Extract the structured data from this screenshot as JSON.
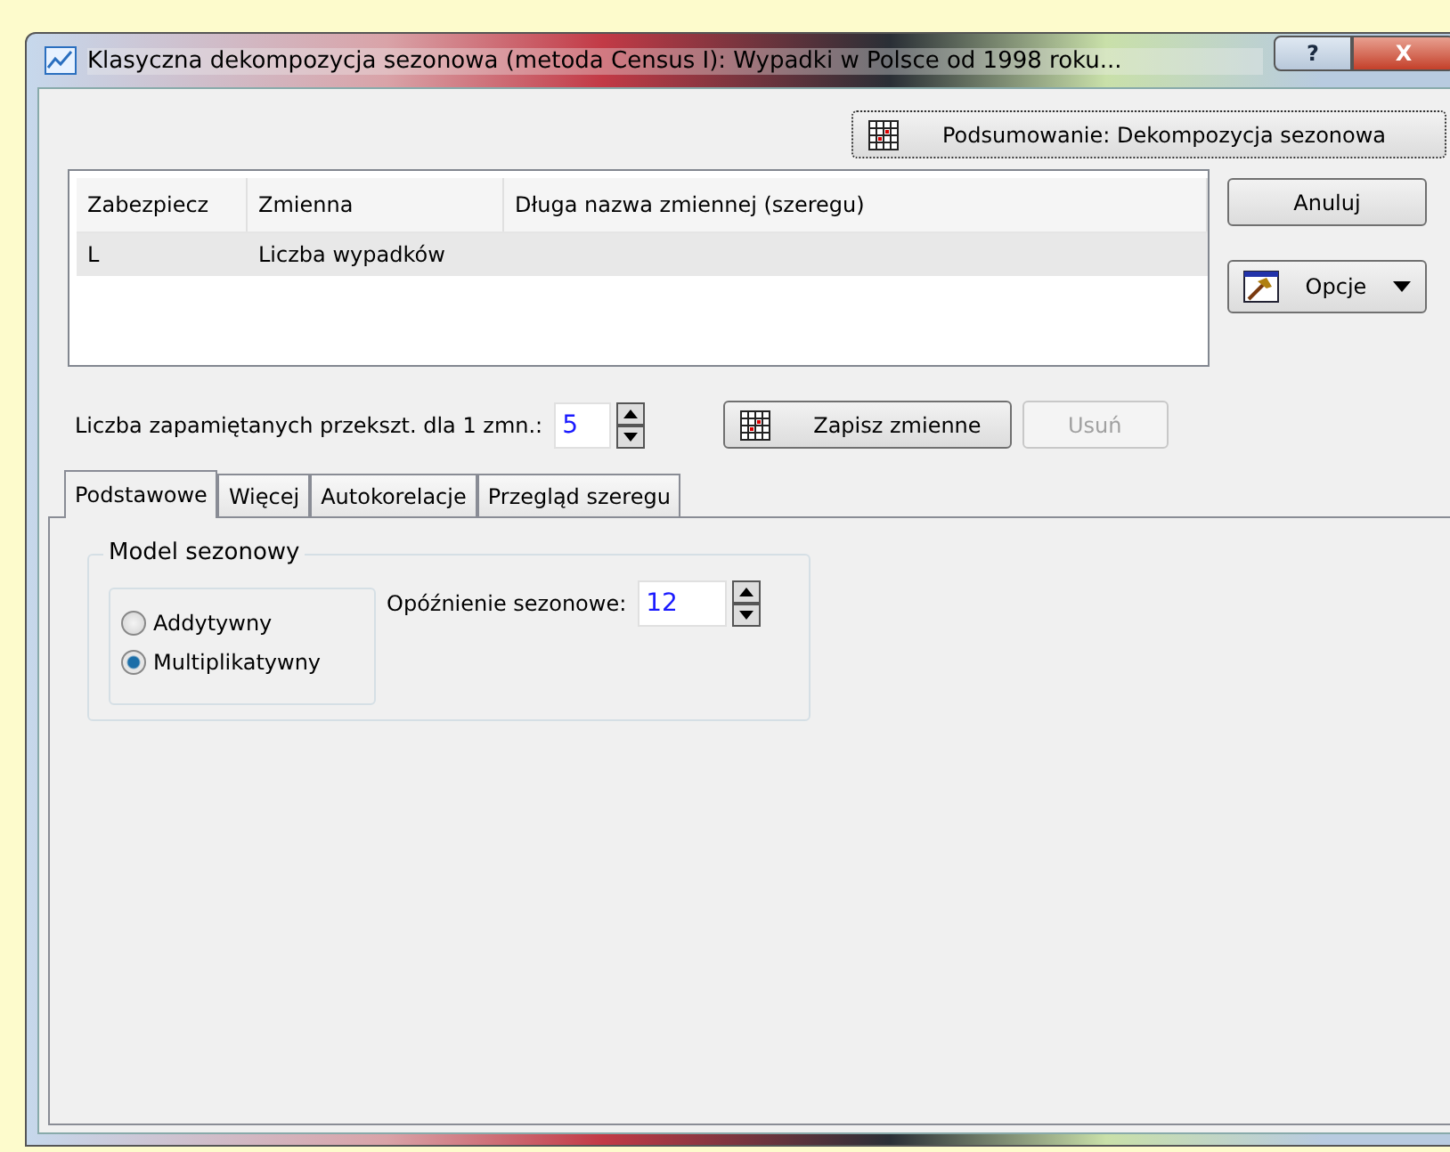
{
  "window": {
    "title": "Klasyczna dekompozycja sezonowa (metoda Census I): Wypadki w Polsce od 1998 roku...",
    "help_button": "?",
    "close_button": "X"
  },
  "summary_button": "Podsumowanie: Dekompozycja sezonowa",
  "table": {
    "columns": [
      "Zabezpiecz",
      "Zmienna",
      "Długa nazwa zmiennej (szeregu)"
    ],
    "rows": [
      {
        "cells": [
          "L",
          "Liczba wypadków",
          ""
        ],
        "selected": true
      }
    ]
  },
  "side_buttons": [
    {
      "label": "Anuluj",
      "kind": "plain"
    },
    {
      "label": "Opcje",
      "kind": "menu"
    }
  ],
  "transforms": {
    "label": "Liczba zapamiętanych przekszt. dla 1 zmn.:",
    "value": "5"
  },
  "save_button": {
    "label": "Zapisz zmienne",
    "disabled": false
  },
  "delete_button": {
    "label": "Usuń",
    "disabled": true
  },
  "tabs": [
    {
      "label": "Podstawowe",
      "selected": true
    },
    {
      "label": "Więcej",
      "selected": false
    },
    {
      "label": "Autokorelacje",
      "selected": false
    },
    {
      "label": "Przegląd szeregu",
      "selected": false
    }
  ],
  "model_group": {
    "title": "Model sezonowy",
    "options": [
      {
        "label": "Addytywny",
        "selected": false
      },
      {
        "label": "Multiplikatywny",
        "selected": true
      }
    ]
  },
  "seasonal_lag": {
    "label": "Opóźnienie sezonowe:",
    "value": "12"
  }
}
